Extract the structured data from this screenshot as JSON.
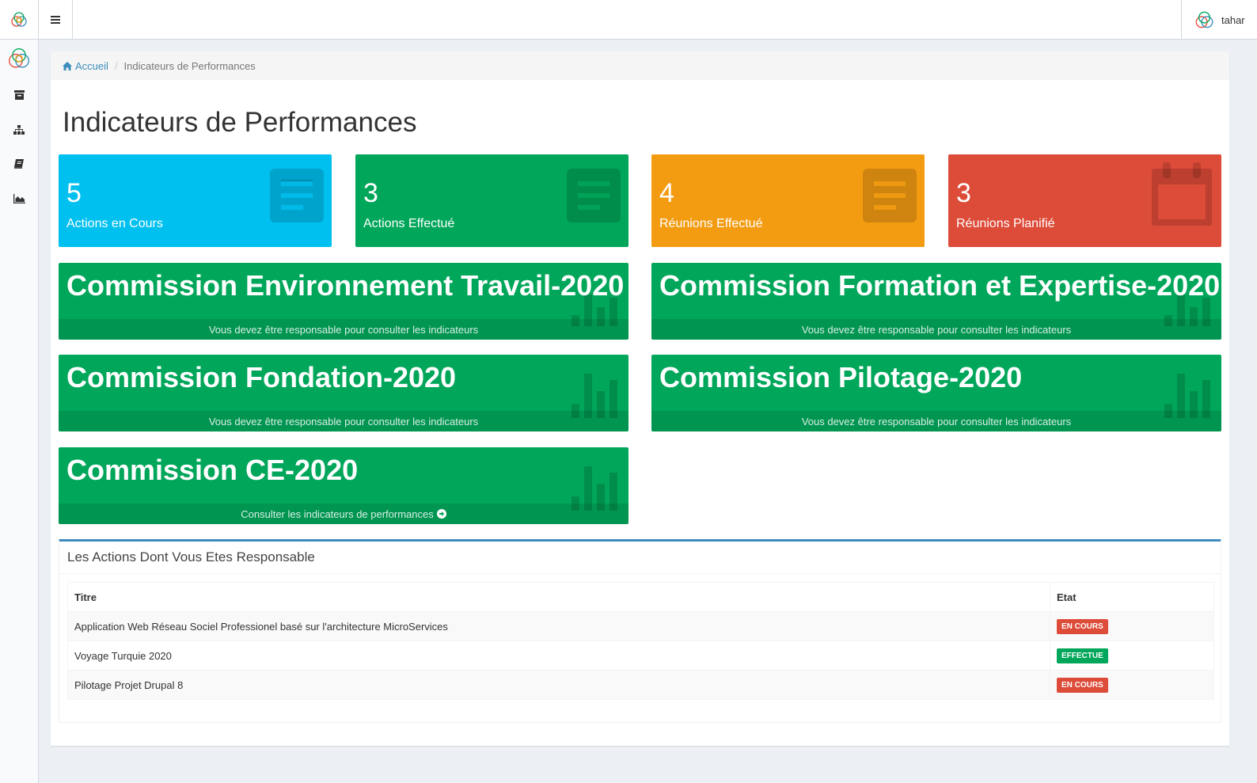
{
  "header": {
    "menu_icon": "hamburger-icon",
    "user_name": "tahar"
  },
  "sidebar": {
    "items": [
      {
        "icon": "logo-icon"
      },
      {
        "icon": "archive-icon"
      },
      {
        "icon": "sitemap-icon"
      },
      {
        "icon": "book-icon"
      },
      {
        "icon": "area-chart-icon"
      }
    ]
  },
  "breadcrumb": {
    "home_label": "Accueil",
    "current": "Indicateurs de Performances"
  },
  "page_title": "Indicateurs de Performances",
  "stats": [
    {
      "value": "5",
      "label": "Actions en Cours",
      "color": "#00c0ef",
      "icon": "list-icon"
    },
    {
      "value": "3",
      "label": "Actions Effectué",
      "color": "#00a65a",
      "icon": "list-icon"
    },
    {
      "value": "4",
      "label": "Réunions Effectué",
      "color": "#f39c12",
      "icon": "list-icon"
    },
    {
      "value": "3",
      "label": "Réunions Planifié",
      "color": "#dd4b39",
      "icon": "calendar-icon"
    }
  ],
  "commissions": [
    {
      "title": "Commission Environnement Travail-2020",
      "footer": "Vous devez être responsable pour consulter les indicateurs"
    },
    {
      "title": "Commission Formation et Expertise-2020",
      "footer": "Vous devez être responsable pour consulter les indicateurs"
    },
    {
      "title": "Commission Fondation-2020",
      "footer": "Vous devez être responsable pour consulter les indicateurs"
    },
    {
      "title": "Commission Pilotage-2020",
      "footer": "Vous devez être responsable pour consulter les indicateurs"
    },
    {
      "title": "Commission CE-2020",
      "footer": "Consulter les indicateurs de performances"
    }
  ],
  "actions_panel": {
    "title": "Les Actions Dont Vous Etes Responsable",
    "columns": [
      "Titre",
      "Etat"
    ],
    "rows": [
      {
        "titre": "Application Web Réseau Sociel Professionel basé sur l'architecture MicroServices",
        "etat": "EN COURS",
        "color": "#dd4b39"
      },
      {
        "titre": "Voyage Turquie 2020",
        "etat": "EFFECTUE",
        "color": "#00a65a"
      },
      {
        "titre": "Pilotage Projet Drupal 8",
        "etat": "EN COURS",
        "color": "#dd4b39"
      }
    ]
  }
}
